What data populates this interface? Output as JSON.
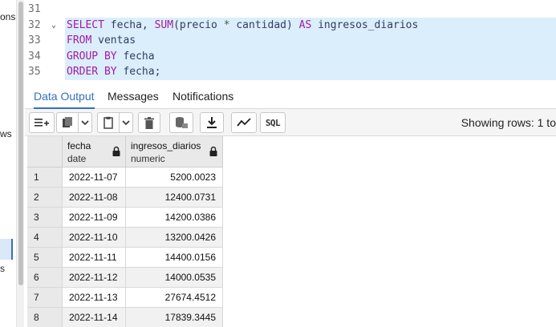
{
  "sidebar": {
    "fragments": [
      "ons",
      "ws",
      "s"
    ]
  },
  "editor": {
    "lines": [
      {
        "num": "31",
        "fold": "",
        "parts": []
      },
      {
        "num": "32",
        "fold": "⌄",
        "parts": [
          {
            "t": "SELECT",
            "c": "kw"
          },
          {
            "t": " fecha, ",
            "c": "fieldc"
          },
          {
            "t": "SUM",
            "c": "fn"
          },
          {
            "t": "(precio ",
            "c": "fieldc"
          },
          {
            "t": "*",
            "c": "op"
          },
          {
            "t": " cantidad) ",
            "c": "fieldc"
          },
          {
            "t": "AS",
            "c": "kw"
          },
          {
            "t": " ingresos_diarios",
            "c": "fieldc"
          }
        ]
      },
      {
        "num": "33",
        "fold": "",
        "parts": [
          {
            "t": "FROM",
            "c": "kw"
          },
          {
            "t": " ventas",
            "c": "fieldc"
          }
        ]
      },
      {
        "num": "34",
        "fold": "",
        "parts": [
          {
            "t": "GROUP BY",
            "c": "kw"
          },
          {
            "t": " fecha",
            "c": "fieldc"
          }
        ]
      },
      {
        "num": "35",
        "fold": "",
        "parts": [
          {
            "t": "ORDER BY",
            "c": "kw"
          },
          {
            "t": " fecha;",
            "c": "fieldc"
          }
        ]
      }
    ]
  },
  "tabs": [
    {
      "label": "Data Output",
      "active": true
    },
    {
      "label": "Messages",
      "active": false
    },
    {
      "label": "Notifications",
      "active": false
    }
  ],
  "toolbar": {
    "sql_label": "SQL",
    "showing": "Showing rows: 1 to"
  },
  "grid": {
    "columns": [
      {
        "name": "fecha",
        "type": "date"
      },
      {
        "name": "ingresos_diarios",
        "type": "numeric"
      }
    ],
    "rows": [
      {
        "n": "1",
        "fecha": "2022-11-07",
        "val": "5200.0023"
      },
      {
        "n": "2",
        "fecha": "2022-11-08",
        "val": "12400.0731"
      },
      {
        "n": "3",
        "fecha": "2022-11-09",
        "val": "14200.0386"
      },
      {
        "n": "4",
        "fecha": "2022-11-10",
        "val": "13200.0426"
      },
      {
        "n": "5",
        "fecha": "2022-11-11",
        "val": "14400.0156"
      },
      {
        "n": "6",
        "fecha": "2022-11-12",
        "val": "14000.0535"
      },
      {
        "n": "7",
        "fecha": "2022-11-13",
        "val": "27674.4512"
      },
      {
        "n": "8",
        "fecha": "2022-11-14",
        "val": "17839.3445"
      }
    ]
  },
  "colors": {
    "accent": "#3271bd",
    "keyword": "#a31aa3",
    "line_highlight": "#dbeefb"
  }
}
